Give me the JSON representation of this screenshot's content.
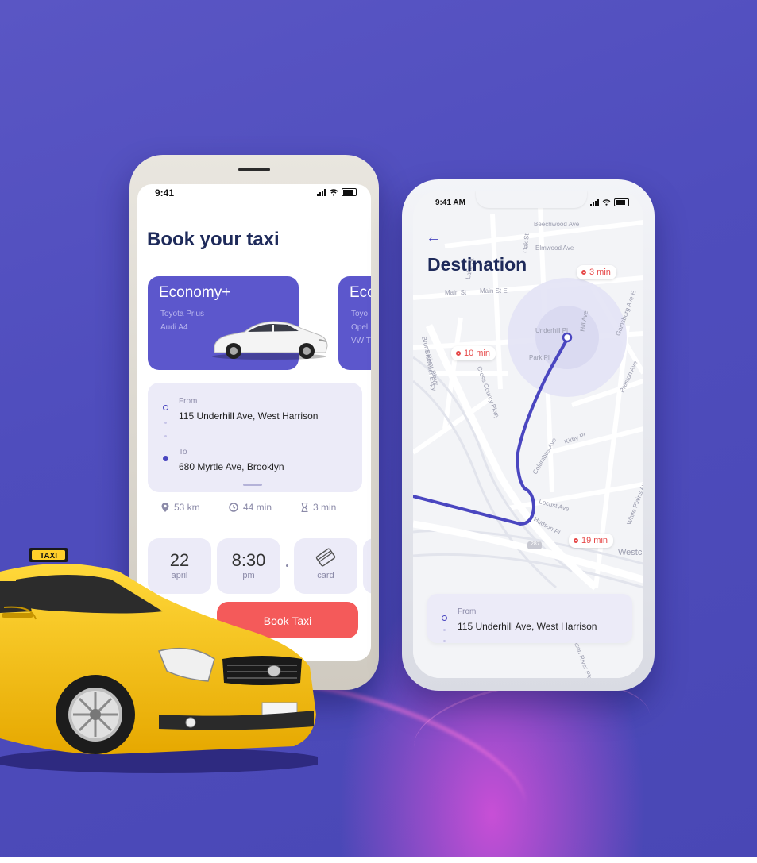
{
  "phone_left": {
    "status_time": "9:41",
    "title": "Book your taxi",
    "car_options": [
      {
        "name": "Economy+",
        "models": [
          "Toyota Prius",
          "Audi A4"
        ]
      },
      {
        "name": "Eco",
        "models": [
          "Toyo",
          "Opel",
          "VW T"
        ]
      }
    ],
    "route": {
      "from_label": "From",
      "from_address": "115 Underhill Ave, West Harrison",
      "to_label": "To",
      "to_address": "680 Myrtle Ave, Brooklyn"
    },
    "stats": {
      "distance": "53 km",
      "duration": "44 min",
      "wait": "3 min"
    },
    "date": {
      "day": "22",
      "month": "april"
    },
    "time": {
      "value": "8:30",
      "period": "pm"
    },
    "payment": {
      "label": "card"
    },
    "book_button": "Book Taxi"
  },
  "phone_right": {
    "status_time": "9:41 AM",
    "title": "Destination",
    "time_pills": [
      "3 min",
      "10 min",
      "19 min"
    ],
    "streets": [
      "Beechwood Ave",
      "Elmwood Ave",
      "Main St",
      "Main St E",
      "Underhill Pl",
      "Park Pl",
      "Hill Ave",
      "Gainsborg Ave E",
      "Preston Ave",
      "Kirby Pl",
      "Columbus Ave",
      "Locust Ave",
      "Hudson Pl",
      "White Plains Ave",
      "Westch",
      "Oak St",
      "Lake St",
      "Bronx River Pkwy",
      "Cross County Pkwy",
      "Hutchinson River Pkwy",
      "Bruckner Expy",
      "287"
    ],
    "from_label": "From",
    "from_address": "115 Underhill Ave, West Harrison"
  },
  "taxi_sign": "TAXI",
  "colors": {
    "primary": "#5c57cc",
    "accent": "#f45a5a",
    "navy": "#1e2a5a",
    "background": "#4f4dbd"
  }
}
